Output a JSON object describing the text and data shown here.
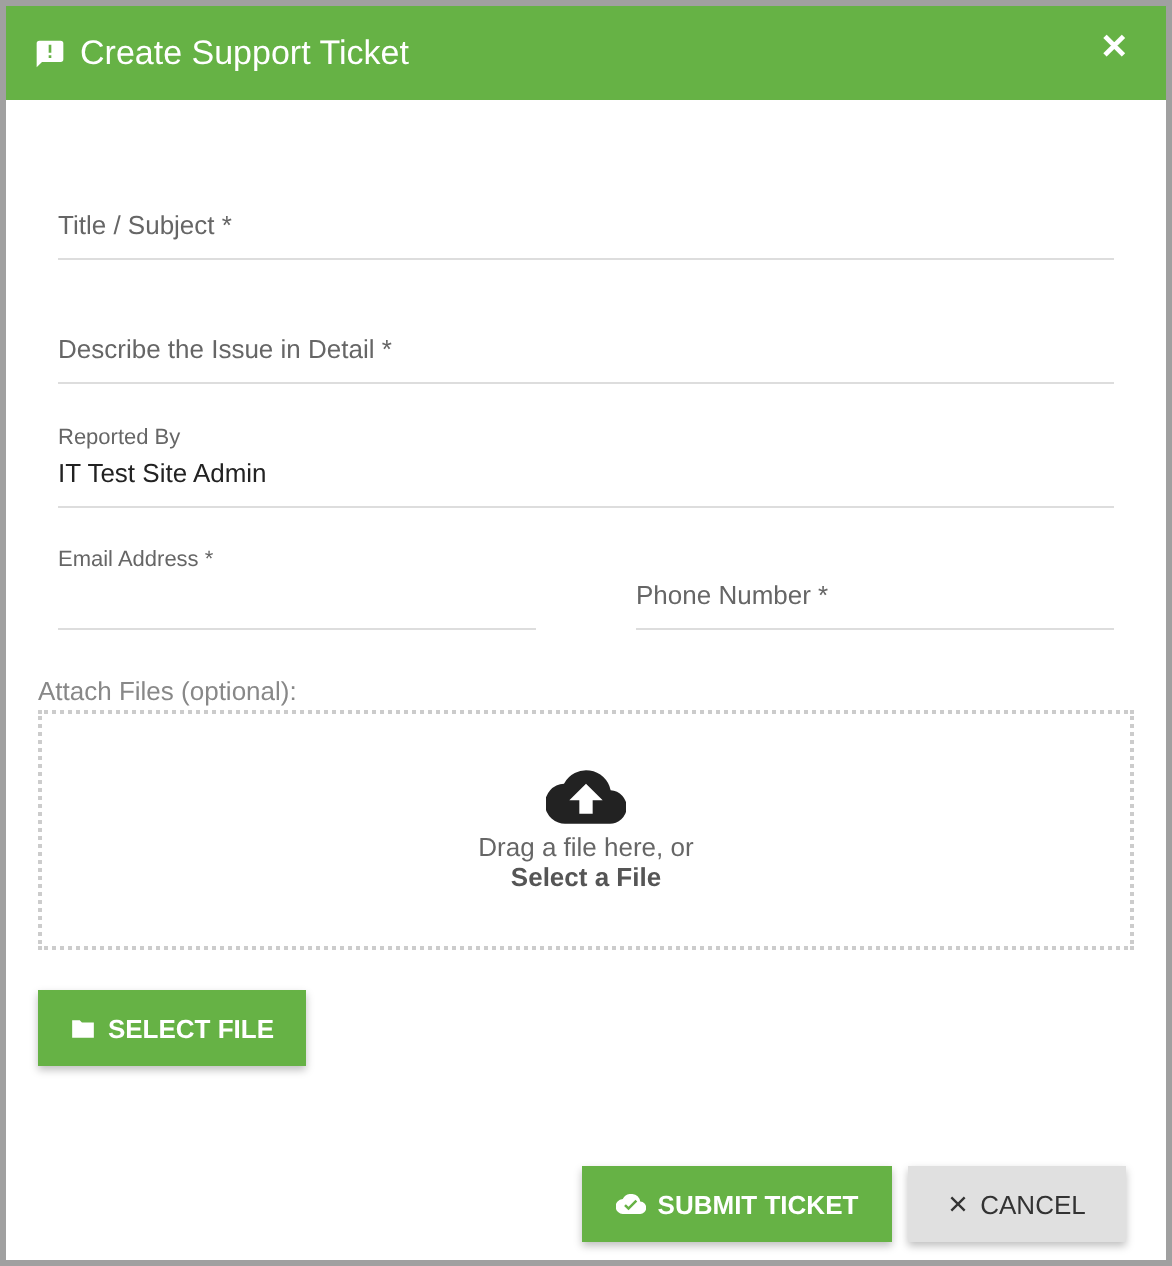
{
  "dialog": {
    "title": "Create Support Ticket",
    "close": "✕"
  },
  "form_rows": [
    [
      {
        "placeholder": "Title / Subject *"
      }
    ],
    [
      {
        "placeholder": "Describe the Issue in Detail *"
      }
    ],
    [
      {
        "label": "Reported By",
        "value": "IT Test Site Admin"
      }
    ],
    [
      {
        "label": "Email Address *"
      },
      {
        "placeholder": "Phone Number *"
      }
    ]
  ],
  "attachments": {
    "label": "Attach Files (optional):",
    "drop_text": "Drag a file here, or",
    "drop_link": "Select a File",
    "button": "SELECT FILE"
  },
  "buttons": [
    {
      "kind": "primary",
      "label": "SUBMIT TICKET"
    },
    {
      "kind": "secondary",
      "label": "CANCEL"
    }
  ]
}
